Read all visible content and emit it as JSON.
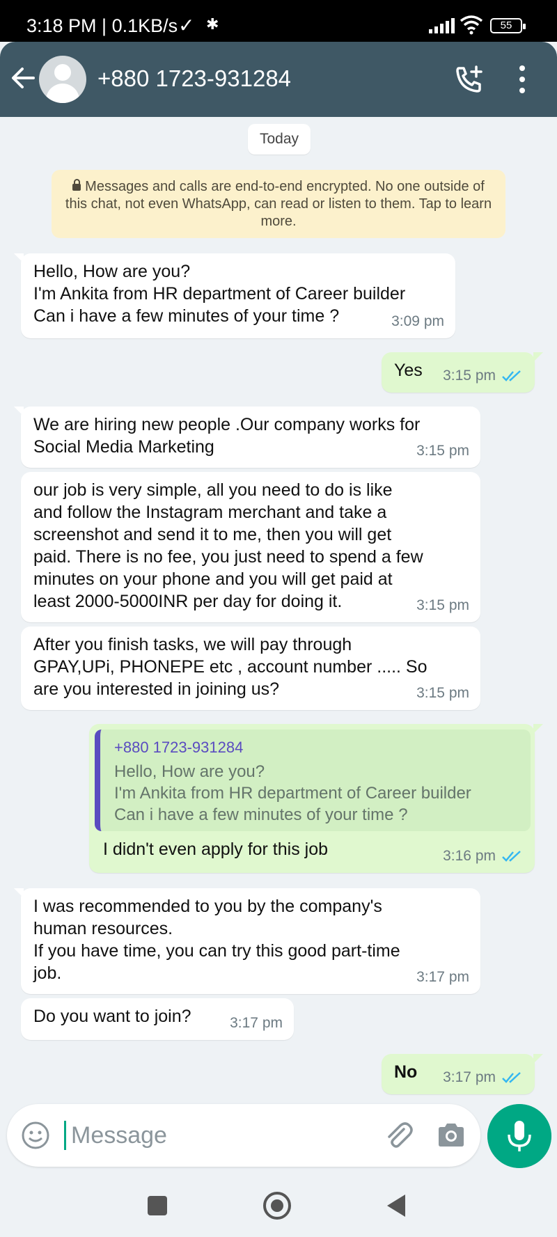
{
  "status_bar": {
    "time_speed": "3:18 PM | 0.1KB/s",
    "check_glyph": "✓",
    "bluetooth_glyph": "✱",
    "battery": "55"
  },
  "header": {
    "contact": "+880 1723-931284",
    "color": "#3f5865"
  },
  "chat": {
    "date_chip": "Today",
    "encryption_notice": "Messages and calls are end-to-end encrypted. No one outside of this chat, not even WhatsApp, can read or listen to them. Tap to learn more.",
    "messages": [
      {
        "dir": "in",
        "text": "Hello, How are you?\nI'm Ankita from HR department of Career builder\nCan i have a few minutes of your time ?",
        "time": "3:09 pm"
      },
      {
        "dir": "out",
        "text": "Yes",
        "time": "3:15 pm",
        "read": true
      },
      {
        "dir": "in",
        "text": "We are hiring new people .Our company works for\nSocial Media Marketing",
        "time": "3:15 pm"
      },
      {
        "dir": "in",
        "text": "our job is very simple, all you need to do is like\nand follow  the Instagram merchant and take a\nscreenshot and send it to me, then you will get\npaid. There is no fee, you just need to spend a few\nminutes on your phone and you will get paid at\nleast 2000-5000INR per day for doing it.",
        "time": "3:15 pm"
      },
      {
        "dir": "in",
        "text": "After you finish tasks, we will pay through\nGPAY,UPi, PHONEPE etc , account number ..... So\nare you interested in joining us?",
        "time": "3:15 pm"
      },
      {
        "dir": "out",
        "quote_name": "+880 1723-931284",
        "quote_text": "Hello, How are you?\nI'm Ankita from HR department of Career builder\nCan i have a few minutes of your time ?",
        "text": "I didn't even apply for this job",
        "time": "3:16 pm",
        "read": true
      },
      {
        "dir": "in",
        "text": "I was recommended to you by the company's\nhuman resources.\nIf you have time, you can try this good part-time\njob.",
        "time": "3:17 pm"
      },
      {
        "dir": "in",
        "text": "Do you want to join?",
        "time": "3:17 pm"
      },
      {
        "dir": "out",
        "text": "No",
        "time": "3:17 pm",
        "read": true
      }
    ]
  },
  "input": {
    "placeholder": "Message"
  },
  "icons": {
    "back": "arrow-left-icon",
    "call": "add-call-icon",
    "menu": "more-vertical-icon",
    "emoji": "smiley-icon",
    "attach": "paperclip-icon",
    "camera": "camera-icon",
    "mic": "microphone-icon"
  },
  "colors": {
    "accent": "#00a884",
    "outgoing_bubble": "#e0f8cf",
    "read_ticks": "#34b7f1"
  }
}
